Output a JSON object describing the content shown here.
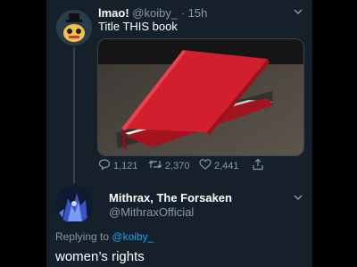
{
  "tweet": {
    "author_name": "lmao!",
    "author_handle": "@koiby_",
    "timestamp": "15h",
    "text": "Title THIS book",
    "actions": {
      "reply_count": "1,121",
      "retweet_count": "2,370",
      "like_count": "2,441"
    }
  },
  "reply": {
    "author_name": "Mithrax, The Forsaken",
    "author_handle": "@MithraxOfficial",
    "replying_label": "Replying to",
    "replying_handle": "@koiby_",
    "text": "women’s rights"
  },
  "icons": [
    "chevron-down-icon",
    "reply-icon",
    "retweet-icon",
    "like-icon",
    "share-icon"
  ],
  "colors": {
    "background": "#15202b",
    "secondary_text": "#8899a6",
    "link": "#1da1f2",
    "book_red": "#d11f2e"
  }
}
